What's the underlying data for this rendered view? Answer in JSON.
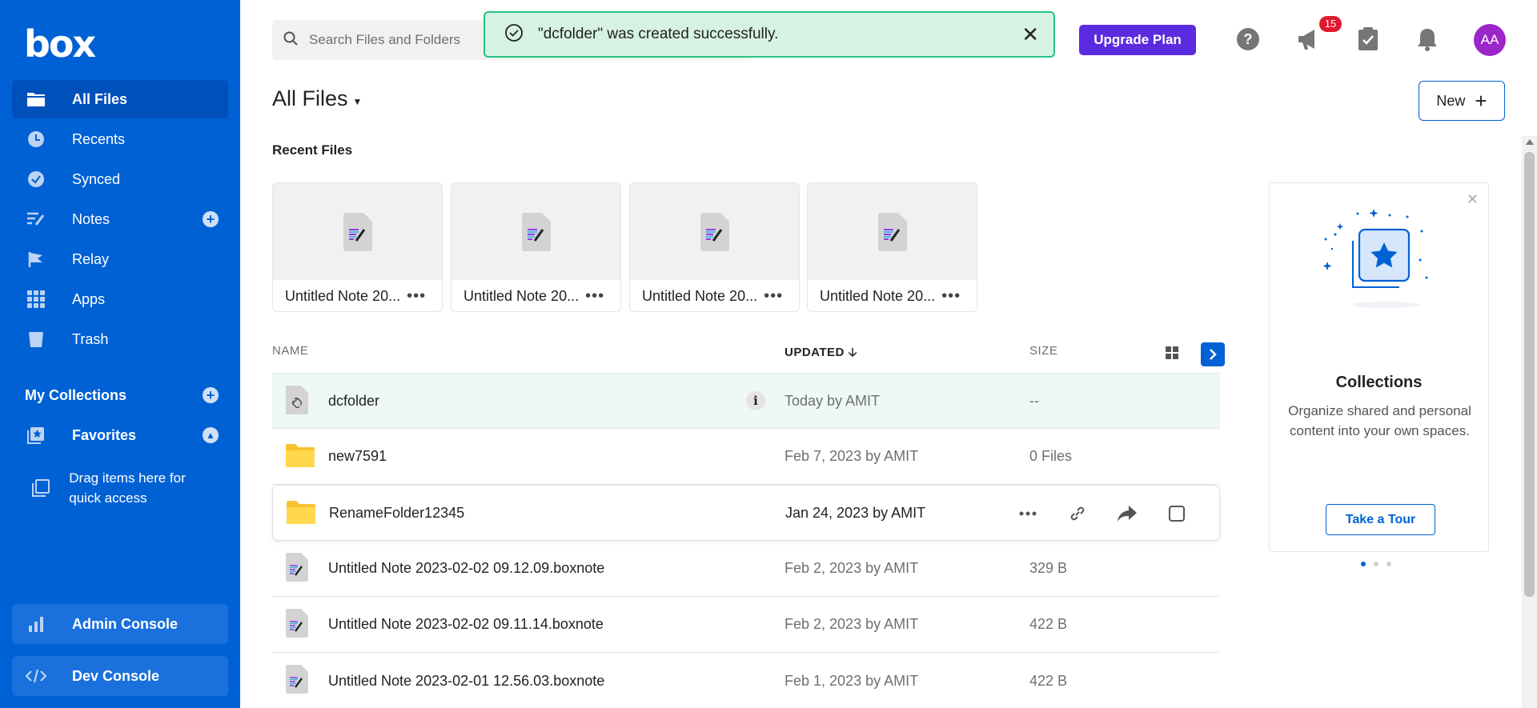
{
  "brand": {
    "logo": "box",
    "accent": "#0061d5"
  },
  "sidebar": {
    "items": [
      {
        "label": "All Files",
        "icon": "folder-icon",
        "active": true
      },
      {
        "label": "Recents",
        "icon": "clock-icon"
      },
      {
        "label": "Synced",
        "icon": "check-circle-icon"
      },
      {
        "label": "Notes",
        "icon": "notes-icon"
      },
      {
        "label": "Relay",
        "icon": "relay-icon"
      },
      {
        "label": "Apps",
        "icon": "apps-grid-icon"
      },
      {
        "label": "Trash",
        "icon": "trash-icon"
      }
    ],
    "collections_label": "My Collections",
    "favorites_label": "Favorites",
    "drag_hint": "Drag items here for quick access",
    "admin_console": "Admin Console",
    "dev_console": "Dev Console"
  },
  "header": {
    "search_placeholder": "Search Files and Folders",
    "toast_message": "\"dcfolder\" was created successfully.",
    "upgrade_label": "Upgrade Plan",
    "notification_count": "15",
    "avatar_initials": "AA"
  },
  "main": {
    "title": "All Files",
    "new_label": "New",
    "recent_title": "Recent Files",
    "recent_files": [
      "Untitled Note 20...",
      "Untitled Note 20...",
      "Untitled Note 20...",
      "Untitled Note 20..."
    ],
    "columns": {
      "name": "NAME",
      "updated": "UPDATED",
      "size": "SIZE"
    },
    "rows": [
      {
        "name": "dcfolder",
        "updated": "Today by AMIT",
        "size": "--",
        "type": "shared-folder"
      },
      {
        "name": "new7591",
        "updated": "Feb 7, 2023 by AMIT",
        "size": "0 Files",
        "type": "folder"
      },
      {
        "name": "RenameFolder12345",
        "updated": "Jan 24, 2023 by AMIT",
        "size": "",
        "type": "folder"
      },
      {
        "name": "Untitled Note 2023-02-02 09.12.09.boxnote",
        "updated": "Feb 2, 2023 by AMIT",
        "size": "329 B",
        "type": "note"
      },
      {
        "name": "Untitled Note 2023-02-02 09.11.14.boxnote",
        "updated": "Feb 2, 2023 by AMIT",
        "size": "422 B",
        "type": "note"
      },
      {
        "name": "Untitled Note 2023-02-01 12.56.03.boxnote",
        "updated": "Feb 1, 2023 by AMIT",
        "size": "422 B",
        "type": "note"
      }
    ]
  },
  "collections_panel": {
    "title": "Collections",
    "description": "Organize shared and personal content into your own spaces.",
    "tour_label": "Take a Tour"
  }
}
